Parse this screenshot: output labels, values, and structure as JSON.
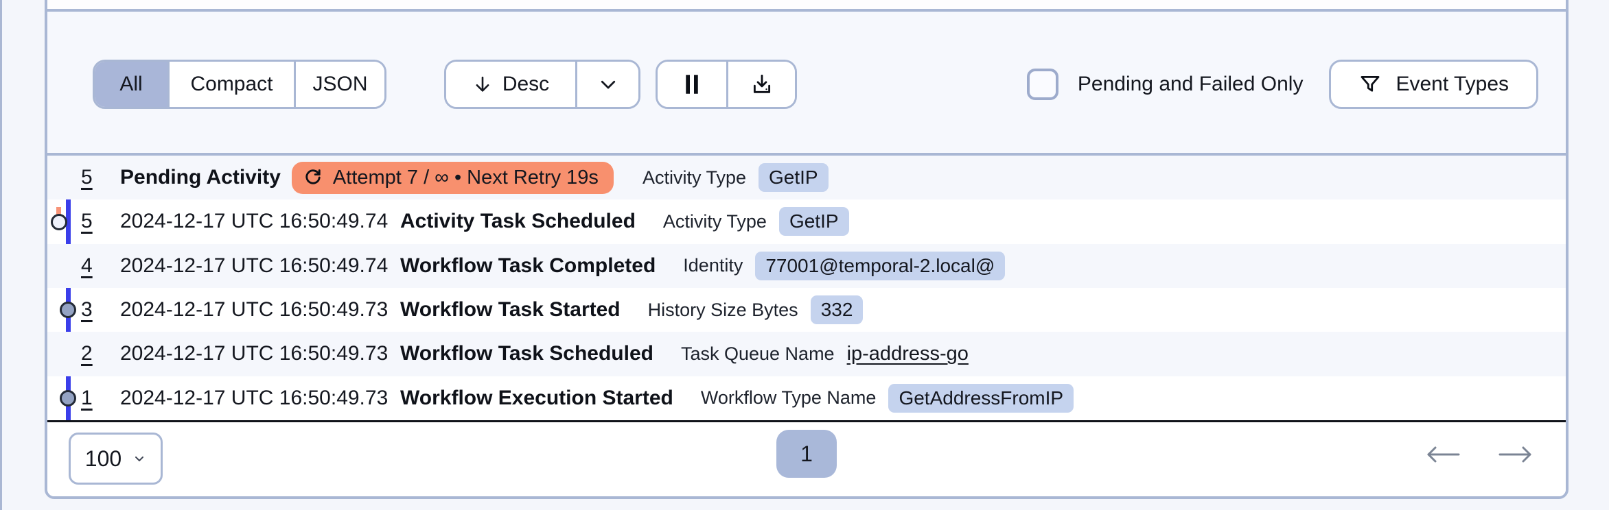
{
  "toolbar": {
    "view_options": {
      "all": "All",
      "compact": "Compact",
      "json": "JSON"
    },
    "active_view": "All",
    "sort_label": "Desc",
    "pending_failed_label": "Pending and Failed Only",
    "event_types_label": "Event Types"
  },
  "events": [
    {
      "id": "5",
      "name": "Pending Activity",
      "retry_badge": "Attempt 7 / ∞ • Next Retry 19s",
      "attr_label": "Activity Type",
      "attr_value": "GetIP"
    },
    {
      "id": "5",
      "time": "2024-12-17 UTC 16:50:49.74",
      "name": "Activity Task Scheduled",
      "attr_label": "Activity Type",
      "attr_value": "GetIP"
    },
    {
      "id": "4",
      "time": "2024-12-17 UTC 16:50:49.74",
      "name": "Workflow Task Completed",
      "attr_label": "Identity",
      "attr_value": "77001@temporal-2.local@"
    },
    {
      "id": "3",
      "time": "2024-12-17 UTC 16:50:49.73",
      "name": "Workflow Task Started",
      "attr_label": "History Size Bytes",
      "attr_value": "332"
    },
    {
      "id": "2",
      "time": "2024-12-17 UTC 16:50:49.73",
      "name": "Workflow Task Scheduled",
      "attr_label": "Task Queue Name",
      "attr_value": "ip-address-go"
    },
    {
      "id": "1",
      "time": "2024-12-17 UTC 16:50:49.73",
      "name": "Workflow Execution Started",
      "attr_label": "Workflow Type Name",
      "attr_value": "GetAddressFromIP"
    }
  ],
  "footer": {
    "page_size": "100",
    "current_page": "1"
  },
  "colors": {
    "accent_badge": "#c5d3ee",
    "pending_badge": "#f8906e",
    "timeline_blue": "#3a3eea",
    "timeline_dashed_orange": "#f89478",
    "completed_green": "#23c45e",
    "selected_segment": "#a9b6d8",
    "panel_border": "#a9b7d4"
  }
}
